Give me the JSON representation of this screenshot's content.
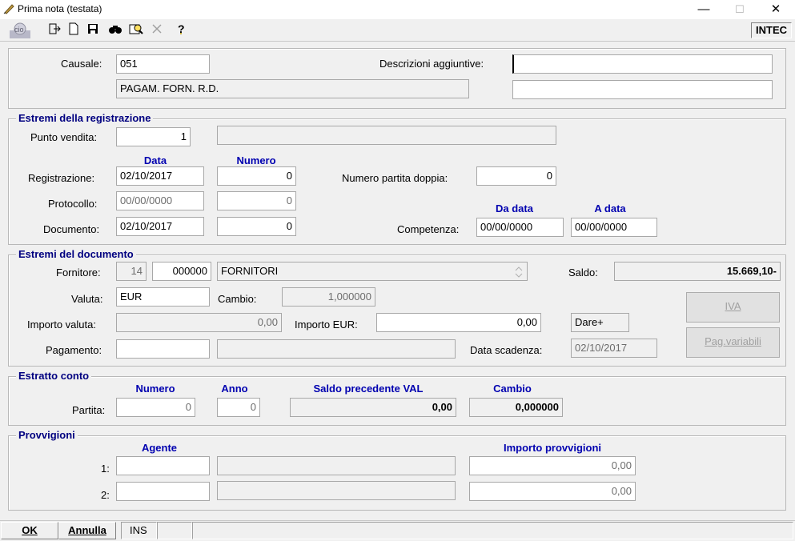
{
  "window": {
    "title": "Prima nota (testata)",
    "minimize": "—",
    "maximize": "☐",
    "close": "✕"
  },
  "toolbar": {
    "brand": "INTEC"
  },
  "header": {
    "causale_label": "Causale:",
    "causale_value": "051",
    "causale_desc": "PAGAM. FORN. R.D.",
    "descr_label": "Descrizioni aggiuntive:",
    "descr1": "",
    "descr2": ""
  },
  "registrazione": {
    "title": "Estremi della registrazione",
    "punto_vendita_label": "Punto vendita:",
    "punto_vendita": "1",
    "punto_vendita_desc": "",
    "col_data": "Data",
    "col_numero": "Numero",
    "registrazione_label": "Registrazione:",
    "reg_data": "02/10/2017",
    "reg_numero": "0",
    "protocollo_label": "Protocollo:",
    "prot_data": "00/00/0000",
    "prot_numero": "0",
    "documento_label": "Documento:",
    "doc_data": "02/10/2017",
    "doc_numero": "0",
    "partita_doppia_label": "Numero partita doppia:",
    "partita_doppia": "0",
    "col_da_data": "Da data",
    "col_a_data": "A data",
    "competenza_label": "Competenza:",
    "comp_da": "00/00/0000",
    "comp_a": "00/00/0000"
  },
  "documento": {
    "title": "Estremi del documento",
    "fornitore_label": "Fornitore:",
    "fornitore_cod1": "14",
    "fornitore_cod2": "000000",
    "fornitore_nome": "FORNITORI",
    "saldo_label": "Saldo:",
    "saldo": "15.669,10-",
    "valuta_label": "Valuta:",
    "valuta": "EUR",
    "cambio_label": "Cambio:",
    "cambio": "1,000000",
    "importo_valuta_label": "Importo valuta:",
    "importo_valuta": "0,00",
    "importo_eur_label": "Importo EUR:",
    "importo_eur": "0,00",
    "dare": "Dare+",
    "iva_button": "IVA",
    "pagamento_label": "Pagamento:",
    "pagamento": "",
    "pagamento_desc": "",
    "scadenza_label": "Data scadenza:",
    "scadenza": "02/10/2017",
    "pag_variabili_button": "Pag.variabili"
  },
  "estratto": {
    "title": "Estratto conto",
    "col_numero": "Numero",
    "col_anno": "Anno",
    "col_saldo_prec": "Saldo precedente VAL",
    "col_cambio": "Cambio",
    "partita_label": "Partita:",
    "numero": "0",
    "anno": "0",
    "saldo_prec": "0,00",
    "cambio": "0,000000"
  },
  "provvigioni": {
    "title": "Provvigioni",
    "col_agente": "Agente",
    "col_importo": "Importo provvigioni",
    "row1_label": "1:",
    "row2_label": "2:",
    "agente1": "",
    "agente1_desc": "",
    "importo1": "0,00",
    "agente2": "",
    "agente2_desc": "",
    "importo2": "0,00"
  },
  "statusbar": {
    "ok": "OK",
    "annulla": "Annulla",
    "mode": "INS"
  }
}
